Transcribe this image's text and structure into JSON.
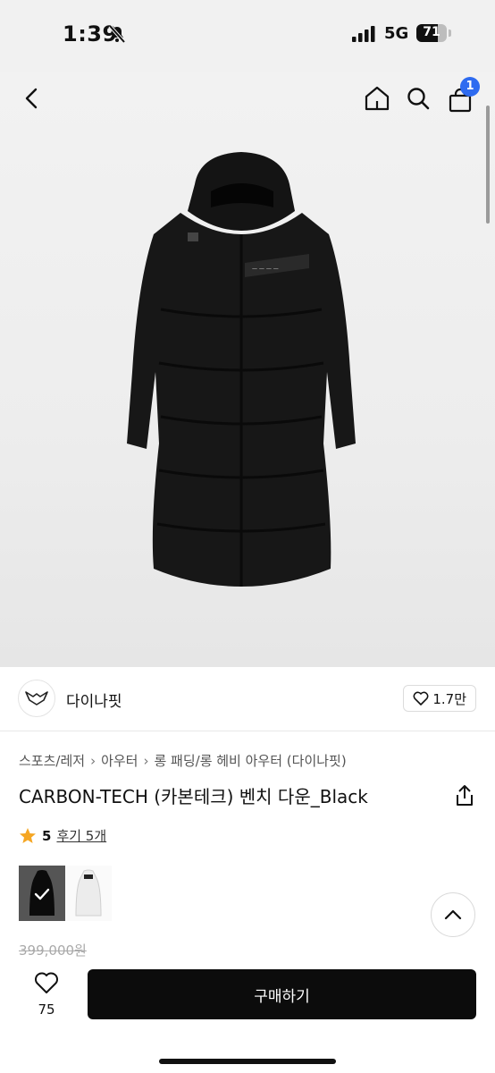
{
  "status_bar": {
    "time": "1:39",
    "network": "5G",
    "battery": "71",
    "battery_level": 0.71
  },
  "nav": {
    "back_icon": "back-chevron-icon",
    "home_icon": "home-icon",
    "search_icon": "search-icon",
    "cart_icon": "bag-icon",
    "cart_badge": "1"
  },
  "seller": {
    "name": "다이나핏",
    "like_count": "1.7만"
  },
  "breadcrumb": {
    "items": [
      "스포츠/레저",
      "아우터",
      "롱 패딩/롱 헤비 아우터 (다이나핏)"
    ]
  },
  "product": {
    "title": "CARBON-TECH (카본테크) 벤치 다운_Black",
    "rating": "5",
    "review_link": "후기 5개",
    "star_color": "#f5a623",
    "original_price": "399,000원",
    "color_options": [
      "black",
      "white"
    ]
  },
  "bottom_bar": {
    "wish_count": "75",
    "buy_label": "구매하기"
  }
}
